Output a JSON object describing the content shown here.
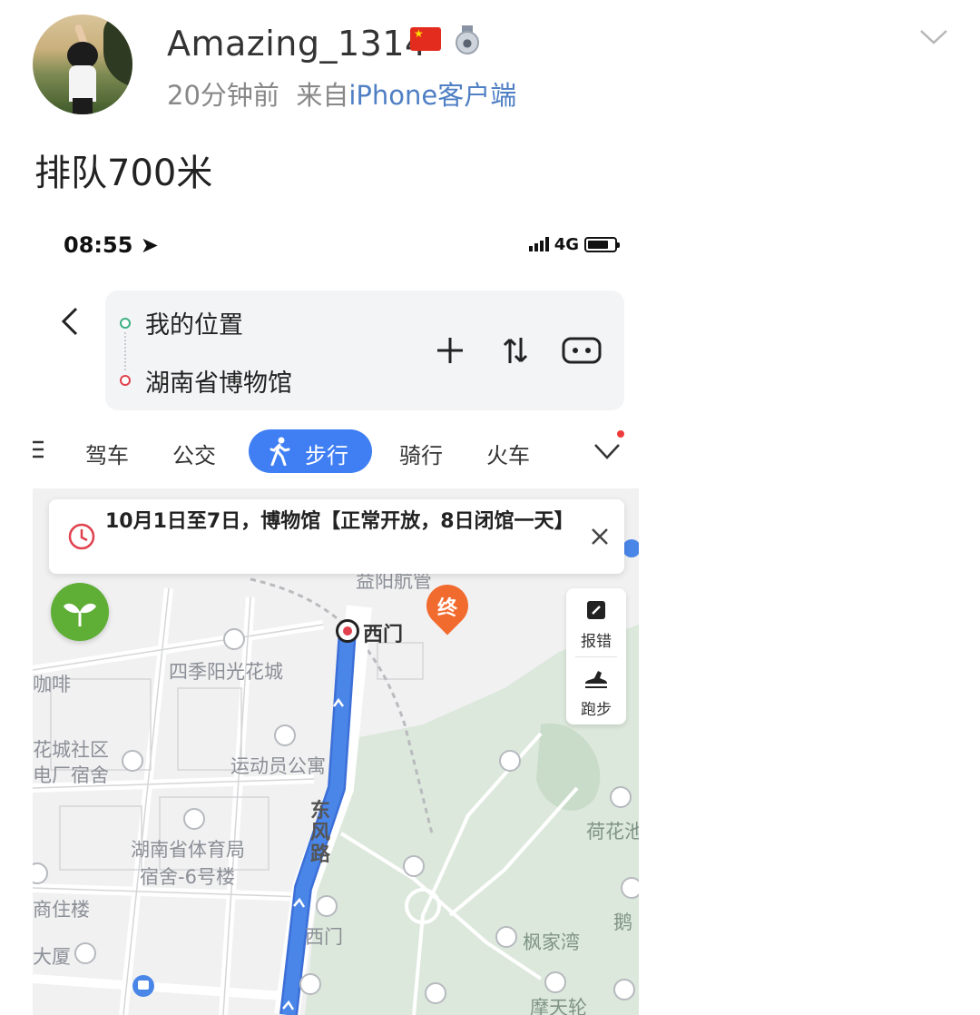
{
  "post": {
    "username": "Amazing_1314",
    "time": "20分钟前",
    "source_prefix": "来自",
    "source": "iPhone客户端",
    "text": "排队700米"
  },
  "phone": {
    "status_time": "08:55",
    "network": "4G",
    "route": {
      "from": "我的位置",
      "to": "湖南省博物馆"
    },
    "modes": {
      "drive": "驾车",
      "bus": "公交",
      "walk": "步行",
      "ride": "骑行",
      "train": "火车"
    },
    "notice": {
      "text": "10月1日至7日，博物馆【正常开放，8日闭馆一天】"
    },
    "tools": {
      "report": "报错",
      "run": "跑步"
    },
    "map": {
      "end_marker": "终",
      "start_label": "西门",
      "road": "东风路",
      "places": {
        "p1": "四季阳光花城",
        "p2": "运动员公寓",
        "p3": "花城社区",
        "p4": "电厂宿舍",
        "p5": "湖南省体育局",
        "p6": "宿舍-6号楼",
        "p7": "商住楼",
        "p8": "大厦",
        "p9": "西门",
        "p10": "枫家湾",
        "p11": "荷花池",
        "p12": "鹅",
        "p13": "咖啡",
        "p14": "益阳航管",
        "p15": "摩天轮"
      }
    },
    "colors": {
      "accent": "#3f7ef3",
      "route_line": "#4a86e8",
      "park": "#dce8dc",
      "end_pin": "#f26b2e"
    }
  }
}
